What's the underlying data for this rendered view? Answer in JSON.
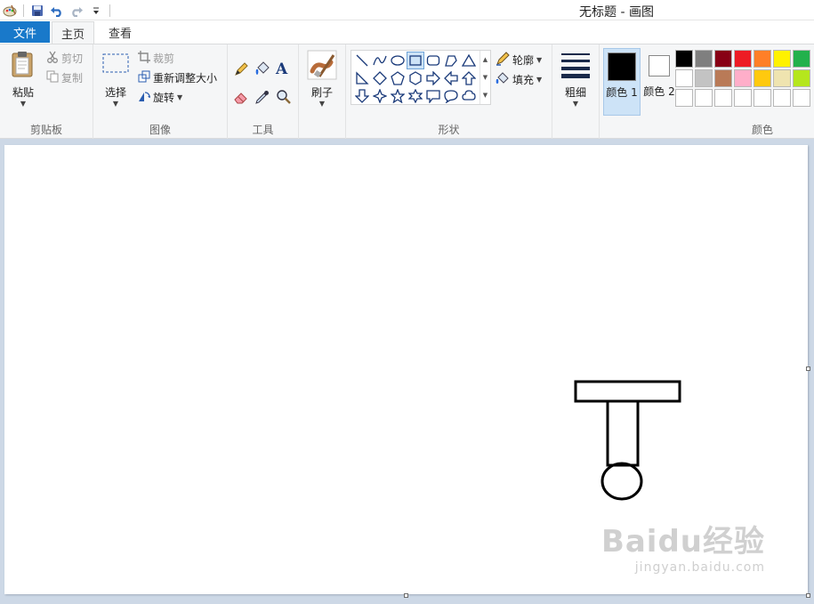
{
  "window": {
    "title": "无标题 - 画图"
  },
  "quick_access": [
    "paint-app-icon",
    "save-icon",
    "undo-icon",
    "redo-icon",
    "customize-dropdown-icon"
  ],
  "tabs": {
    "file": "文件",
    "home": "主页",
    "view": "查看"
  },
  "ribbon": {
    "clipboard": {
      "label": "剪贴板",
      "paste": "粘贴",
      "cut": "剪切",
      "copy": "复制"
    },
    "image": {
      "label": "图像",
      "select": "选择",
      "crop": "裁剪",
      "resize": "重新调整大小",
      "rotate": "旋转"
    },
    "tools": {
      "label": "工具"
    },
    "brushes": {
      "label": "刷子"
    },
    "shapes": {
      "label": "形状",
      "outline": "轮廓",
      "fill": "填充"
    },
    "size": {
      "label": "粗细"
    },
    "colors": {
      "label": "颜色",
      "color1": "颜色 1",
      "color2": "颜色 2",
      "color1_value": "#000000",
      "color2_value": "#ffffff",
      "palette_row1": [
        "#000000",
        "#7f7f7f",
        "#880015",
        "#ed1c24",
        "#ff7f27",
        "#fff200",
        "#22b14c"
      ],
      "palette_row2": [
        "#ffffff",
        "#c3c3c3",
        "#b97a57",
        "#ffaec9",
        "#ffc90e",
        "#efe4b0",
        "#b5e61d"
      ],
      "palette_row3": [
        "#ffffff",
        "#ffffff",
        "#ffffff",
        "#ffffff",
        "#ffffff",
        "#ffffff",
        "#ffffff"
      ]
    }
  },
  "canvas": {
    "background": "#ffffff"
  },
  "watermark": {
    "brand": "Baidu经验",
    "url": "jingyan.baidu.com"
  }
}
